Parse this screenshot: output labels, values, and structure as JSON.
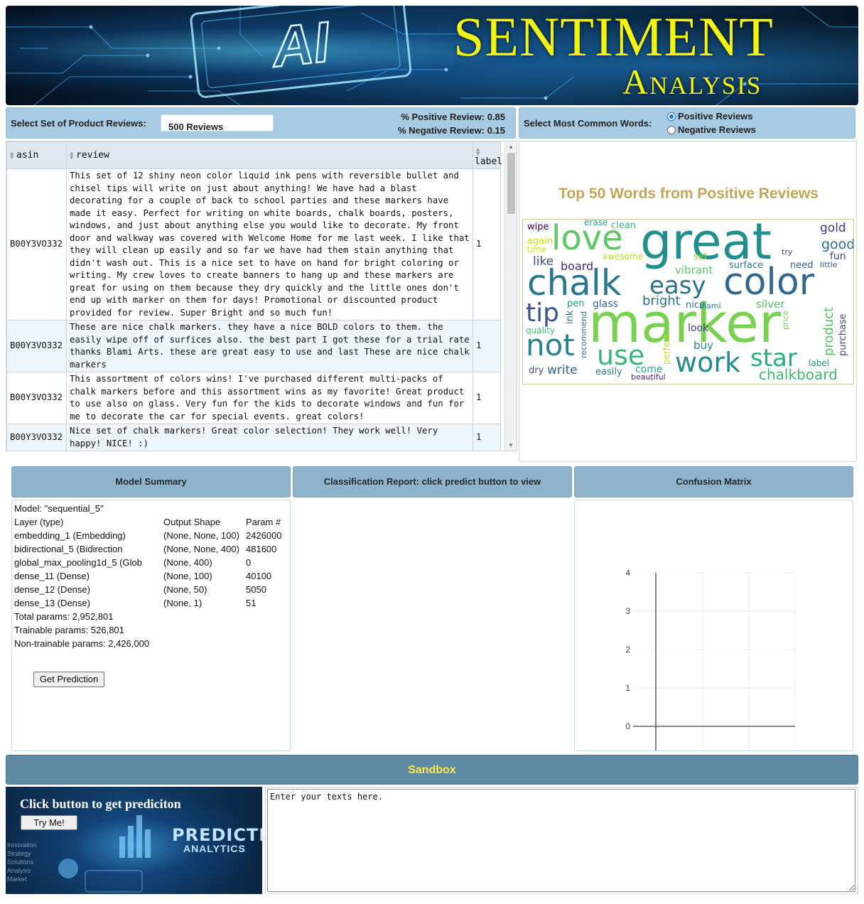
{
  "banner": {
    "title": "SENTIMENT",
    "subtitle": "Analysis",
    "ai_text": "AI"
  },
  "reviews_control": {
    "label": "Select Set of Product Reviews:",
    "selected": "500 Reviews",
    "positive_text": "% Positive Review: 0.85",
    "negative_text": "% Negative Review: 0.15"
  },
  "words_control": {
    "label": "Select Most Common Words:",
    "options": [
      "Positive Reviews",
      "Negative Reviews"
    ],
    "selected": "Positive Reviews"
  },
  "table": {
    "columns": [
      "asin",
      "review",
      "label"
    ],
    "rows": [
      {
        "asin": "B00Y3VO332",
        "review": "This set of 12 shiny neon color liquid ink pens with reversible bullet and chisel tips will write on just about anything! We have had a blast decorating for a couple of back to school parties and these markers have made it easy. Perfect for writing on white boards, chalk boards, posters, windows, and just about anything else you would like to decorate. My front door and walkway was covered with Welcome Home for me last week. I like that they will clean up easily and so far we have had them stain anything that didn't wash out. This is a nice set to have on hand for bright coloring or writing. My crew loves to create banners to hang up and these markers are great for using on them because they dry quickly and the little ones don't end up with marker on them for days! Promotional or discounted product provided for review. Super Bright and so much fun!",
        "label": "1"
      },
      {
        "asin": "B00Y3VO332",
        "review": "These are nice chalk markers. they have a nice BOLD colors to them. the easily wipe off of surfices also. the best part I got these for a trial rate thanks Blami Arts. these are great easy to use and last These are nice chalk markers",
        "label": "1"
      },
      {
        "asin": "B00Y3VO332",
        "review": "This assortment of colors wins! I've purchased different multi-packs of chalk markers before and this assortment wins as my favorite! Great product to use also on glass. Very fun for the kids to decorate windows and fun for me to decorate the car for special events. great colors!",
        "label": "1"
      },
      {
        "asin": "B00Y3VO332",
        "review": "Nice set of chalk markers! Great color selection! They work well! Very happy! NICE! :)",
        "label": "1"
      }
    ]
  },
  "wordcloud": {
    "title": "Top 50 Words from Positive Reviews",
    "words": [
      {
        "text": "great",
        "color": "#21908d"
      },
      {
        "text": "marker",
        "color": "#7ad151"
      },
      {
        "text": "color",
        "color": "#31688e"
      },
      {
        "text": "chalk",
        "color": "#2a788e"
      },
      {
        "text": "love",
        "color": "#5ec962"
      },
      {
        "text": "easy",
        "color": "#2c728e"
      },
      {
        "text": "tip",
        "color": "#3b528b"
      },
      {
        "text": "not",
        "color": "#26828e"
      },
      {
        "text": "use",
        "color": "#35b779"
      },
      {
        "text": "work",
        "color": "#238a8d"
      },
      {
        "text": "star",
        "color": "#29af7f"
      },
      {
        "text": "chalkboard",
        "color": "#3fbc73"
      },
      {
        "text": "gold",
        "color": "#453781"
      },
      {
        "text": "good",
        "color": "#2d708e"
      },
      {
        "text": "fun",
        "color": "#3e4989"
      },
      {
        "text": "vibrant",
        "color": "#5ec962"
      },
      {
        "text": "like",
        "color": "#3e4989"
      },
      {
        "text": "board",
        "color": "#482878"
      },
      {
        "text": "bright",
        "color": "#2c728e"
      },
      {
        "text": "surface",
        "color": "#287c8e"
      },
      {
        "text": "need",
        "color": "#33638d"
      },
      {
        "text": "little",
        "color": "#365c8d"
      },
      {
        "text": "silver",
        "color": "#4ac16d"
      },
      {
        "text": "product",
        "color": "#52c569"
      },
      {
        "text": "purchase",
        "color": "#3e4a89"
      },
      {
        "text": "price",
        "color": "#73d056"
      },
      {
        "text": "wipe",
        "color": "#440154"
      },
      {
        "text": "erase",
        "color": "#22a884"
      },
      {
        "text": "clean",
        "color": "#38b977"
      },
      {
        "text": "again",
        "color": "#c8e020"
      },
      {
        "text": "time",
        "color": "#d2e21b"
      },
      {
        "text": "awesome",
        "color": "#b5de2b"
      },
      {
        "text": "set",
        "color": "#8fd744"
      },
      {
        "text": "try",
        "color": "#424086"
      },
      {
        "text": "pen",
        "color": "#20a386"
      },
      {
        "text": "glass",
        "color": "#31688e"
      },
      {
        "text": "nice",
        "color": "#2a788e"
      },
      {
        "text": "blami",
        "color": "#27808e"
      },
      {
        "text": "ink",
        "color": "#2e6e8e"
      },
      {
        "text": "quality",
        "color": "#40bd72"
      },
      {
        "text": "recommend",
        "color": "#2b758e"
      },
      {
        "text": "perfect",
        "color": "#c0df25"
      },
      {
        "text": "look",
        "color": "#424086"
      },
      {
        "text": "buy",
        "color": "#23898e"
      },
      {
        "text": "label",
        "color": "#1f968b"
      },
      {
        "text": "dry",
        "color": "#3b528b"
      },
      {
        "text": "write",
        "color": "#33638d"
      },
      {
        "text": "easily",
        "color": "#2a788e"
      },
      {
        "text": "come",
        "color": "#26ad81"
      },
      {
        "text": "beautiful",
        "color": "#482677"
      }
    ]
  },
  "model_summary": {
    "header": "Model Summary",
    "model_line": "Model: \"sequential_5\"",
    "columns": [
      "Layer (type)",
      "Output Shape",
      "Param #"
    ],
    "layers": [
      {
        "layer": "embedding_1 (Embedding)",
        "shape": "(None, None, 100)",
        "params": "2426000"
      },
      {
        "layer": "bidirectional_5 (Bidirection",
        "shape": "(None, None, 400)",
        "params": "481600"
      },
      {
        "layer": "global_max_pooling1d_5 (Glob",
        "shape": "(None, 400)",
        "params": "0"
      },
      {
        "layer": "dense_11 (Dense)",
        "shape": "(None, 100)",
        "params": "40100"
      },
      {
        "layer": "dense_12 (Dense)",
        "shape": "(None, 50)",
        "params": "5050"
      },
      {
        "layer": "dense_13 (Dense)",
        "shape": "(None, 1)",
        "params": "51"
      }
    ],
    "total": "Total params: 2,952,801",
    "trainable": "Trainable params: 526,801",
    "non_trainable": "Non-trainable params: 2,426,000",
    "button": "Get Prediction"
  },
  "classification": {
    "header": "Classification Report: click predict button to view"
  },
  "confusion": {
    "header": "Confusion Matrix"
  },
  "chart_data": {
    "type": "line",
    "title": "",
    "xlabel": "",
    "ylabel": "",
    "series": [],
    "ylim": [
      0,
      4
    ],
    "yticks": [
      "0",
      "1",
      "2",
      "3",
      "4"
    ],
    "grid": true
  },
  "sandbox": {
    "header": "Sandbox",
    "caption": "Click button to get prediciton",
    "button": "Try Me!",
    "image_title": "PREDICTIVE",
    "image_subtitle": "ANALYTICS",
    "side_words": [
      "Innovation",
      "Strategy",
      "Solutions",
      "Analysis",
      "Market"
    ],
    "textarea_value": "Enter your texts here."
  }
}
